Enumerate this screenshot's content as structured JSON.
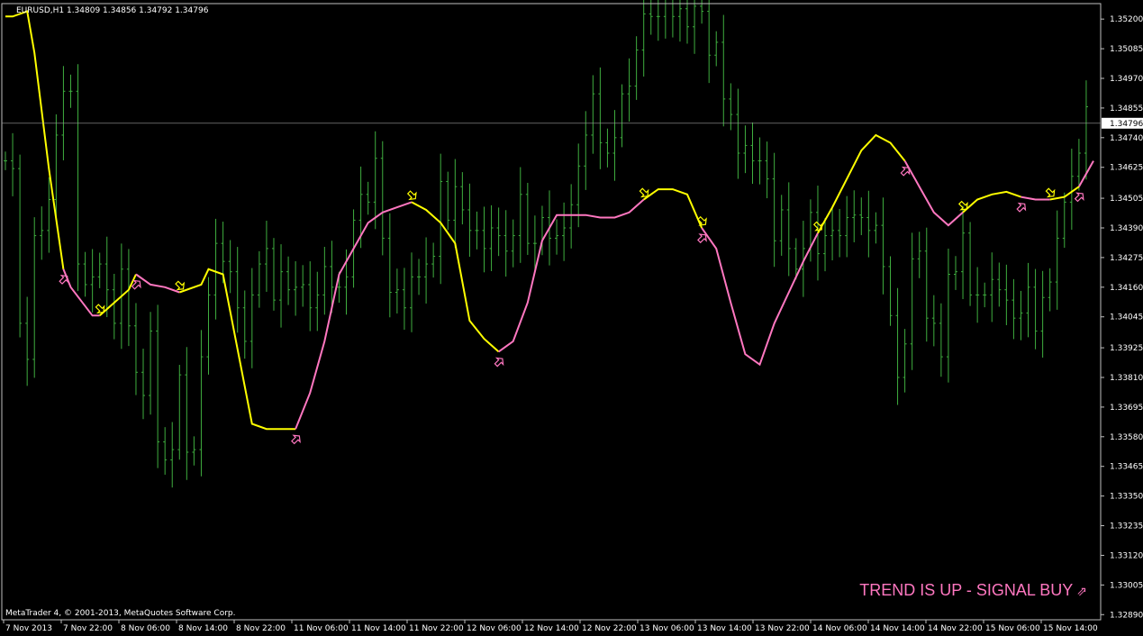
{
  "window": {
    "title": "EURUSD,H1  1.34809 1.34856 1.34792 1.34796",
    "copyright": "MetaTrader 4, © 2001-2013, MetaQuotes Software Corp."
  },
  "signal": {
    "text": "TREND IS UP - SIGNAL BUY",
    "arrow": "⇗",
    "color": "#ff77c0"
  },
  "colors": {
    "background": "#000000",
    "candles": "#3fae3f",
    "trend_up": "#ff77c0",
    "trend_down": "#ffff00",
    "axis": "#c0c0c0",
    "price_badge_bg": "#ffffff",
    "price_badge_text": "#000000"
  },
  "chart_data": {
    "type": "line",
    "symbol": "EURUSD",
    "timeframe": "H1",
    "current_price": "1.34796",
    "y_ticks": [
      "1.35200",
      "1.35085",
      "1.34970",
      "1.34855",
      "1.34740",
      "1.34625",
      "1.34505",
      "1.34390",
      "1.34275",
      "1.34160",
      "1.34045",
      "1.33925",
      "1.33810",
      "1.33695",
      "1.33580",
      "1.33465",
      "1.33350",
      "1.33235",
      "1.33120",
      "1.33005",
      "1.32890"
    ],
    "y_tick_values": [
      1.352,
      1.35085,
      1.3497,
      1.34855,
      1.3474,
      1.34625,
      1.34505,
      1.3439,
      1.34275,
      1.3416,
      1.34045,
      1.33925,
      1.3381,
      1.33695,
      1.3358,
      1.33465,
      1.3335,
      1.33235,
      1.3312,
      1.33005,
      1.3289
    ],
    "ylim": [
      1.3287,
      1.3526
    ],
    "x_ticks": [
      "7 Nov 2013",
      "7 Nov 22:00",
      "8 Nov 06:00",
      "8 Nov 14:00",
      "8 Nov 22:00",
      "11 Nov 06:00",
      "11 Nov 14:00",
      "11 Nov 22:00",
      "12 Nov 06:00",
      "12 Nov 14:00",
      "12 Nov 22:00",
      "13 Nov 06:00",
      "13 Nov 14:00",
      "13 Nov 22:00",
      "14 Nov 06:00",
      "14 Nov 14:00",
      "14 Nov 22:00",
      "15 Nov 06:00",
      "15 Nov 14:00"
    ],
    "bar_count": 150,
    "candles": {
      "closes": [
        1.3465,
        1.3462,
        1.3402,
        1.3388,
        1.3436,
        1.3438,
        1.345,
        1.3475,
        1.3492,
        1.3492,
        1.3425,
        1.3417,
        1.342,
        1.3425,
        1.3415,
        1.3402,
        1.3423,
        1.3401,
        1.3383,
        1.3374,
        1.3399,
        1.3356,
        1.3349,
        1.3353,
        1.3382,
        1.3352,
        1.3353,
        1.3389,
        1.3413,
        1.3433,
        1.3426,
        1.3422,
        1.3408,
        1.3395,
        1.3413,
        1.3425,
        1.3431,
        1.3411,
        1.3422,
        1.3415,
        1.3416,
        1.3417,
        1.3408,
        1.3413,
        1.3424,
        1.3416,
        1.3416,
        1.342,
        1.3442,
        1.3452,
        1.3449,
        1.3466,
        1.3435,
        1.3414,
        1.3415,
        1.3408,
        1.342,
        1.342,
        1.3425,
        1.3428,
        1.3457,
        1.3442,
        1.3455,
        1.3446,
        1.3438,
        1.3438,
        1.3431,
        1.3439,
        1.3436,
        1.343,
        1.3436,
        1.3452,
        1.3433,
        1.3433,
        1.3443,
        1.3435,
        1.3436,
        1.3439,
        1.3448,
        1.3463,
        1.3475,
        1.3491,
        1.3472,
        1.3468,
        1.3474,
        1.3491,
        1.3494,
        1.3508,
        1.3522,
        1.3521,
        1.3521,
        1.3526,
        1.3521,
        1.3524,
        1.3517,
        1.3525,
        1.3523,
        1.3506,
        1.3511,
        1.3489,
        1.3483,
        1.3468,
        1.3471,
        1.3465,
        1.3465,
        1.3458,
        1.3434,
        1.3446,
        1.3431,
        1.3423,
        1.3431,
        1.3445,
        1.3429,
        1.3436,
        1.3438,
        1.3436,
        1.3443,
        1.3444,
        1.3443,
        1.3438,
        1.344,
        1.3424,
        1.3405,
        1.3381,
        1.3394,
        1.3427,
        1.343,
        1.3404,
        1.3402,
        1.3389,
        1.3421,
        1.3422,
        1.3437,
        1.3413,
        1.3413,
        1.3413,
        1.3419,
        1.3415,
        1.3411,
        1.3404,
        1.3406,
        1.3416,
        1.3399,
        1.3412,
        1.3418,
        1.3435,
        1.3449,
        1.3459,
        1.3468,
        1.3486
      ]
    },
    "trend_line": [
      [
        0,
        1.3521
      ],
      [
        1,
        1.3521
      ],
      [
        3,
        1.3523
      ],
      [
        4,
        1.3507
      ],
      [
        6,
        1.3462
      ],
      [
        8,
        1.3423
      ],
      [
        9,
        1.3416
      ],
      [
        12,
        1.3405
      ],
      [
        13,
        1.3405
      ],
      [
        15,
        1.341
      ],
      [
        17,
        1.3415
      ],
      [
        18,
        1.3421
      ],
      [
        20,
        1.3417
      ],
      [
        22,
        1.3416
      ],
      [
        24,
        1.3414
      ],
      [
        27,
        1.3417
      ],
      [
        28,
        1.3423
      ],
      [
        30,
        1.3421
      ],
      [
        34,
        1.3363
      ],
      [
        36,
        1.3361
      ],
      [
        40,
        1.3361
      ],
      [
        42,
        1.3375
      ],
      [
        44,
        1.3395
      ],
      [
        46,
        1.3421
      ],
      [
        48,
        1.3431
      ],
      [
        50,
        1.3441
      ],
      [
        52,
        1.3445
      ],
      [
        54,
        1.3447
      ],
      [
        56,
        1.3449
      ],
      [
        58,
        1.3446
      ],
      [
        60,
        1.3441
      ],
      [
        62,
        1.3433
      ],
      [
        64,
        1.3403
      ],
      [
        66,
        1.3396
      ],
      [
        68,
        1.3391
      ],
      [
        70,
        1.3395
      ],
      [
        72,
        1.341
      ],
      [
        74,
        1.3434
      ],
      [
        76,
        1.3444
      ],
      [
        78,
        1.3444
      ],
      [
        80,
        1.3444
      ],
      [
        82,
        1.3443
      ],
      [
        84,
        1.3443
      ],
      [
        86,
        1.3445
      ],
      [
        88,
        1.345
      ],
      [
        90,
        1.3454
      ],
      [
        92,
        1.3454
      ],
      [
        94,
        1.3452
      ],
      [
        96,
        1.3439
      ],
      [
        98,
        1.3431
      ],
      [
        100,
        1.341
      ],
      [
        102,
        1.339
      ],
      [
        104,
        1.3386
      ],
      [
        106,
        1.3402
      ],
      [
        108,
        1.3414
      ],
      [
        110,
        1.3426
      ],
      [
        112,
        1.3437
      ],
      [
        114,
        1.3447
      ],
      [
        116,
        1.3458
      ],
      [
        118,
        1.3469
      ],
      [
        120,
        1.3475
      ],
      [
        122,
        1.3472
      ],
      [
        124,
        1.3465
      ],
      [
        126,
        1.3455
      ],
      [
        128,
        1.3445
      ],
      [
        130,
        1.344
      ],
      [
        132,
        1.3445
      ],
      [
        134,
        1.345
      ],
      [
        136,
        1.3452
      ],
      [
        138,
        1.3453
      ],
      [
        140,
        1.3451
      ],
      [
        142,
        1.345
      ],
      [
        144,
        1.345
      ],
      [
        146,
        1.3451
      ],
      [
        148,
        1.3455
      ],
      [
        150,
        1.3465
      ]
    ],
    "segments": [
      {
        "trend": "down",
        "from": 0,
        "to": 8
      },
      {
        "trend": "up",
        "from": 8,
        "to": 13
      },
      {
        "trend": "down",
        "from": 13,
        "to": 18
      },
      {
        "trend": "up",
        "from": 18,
        "to": 24
      },
      {
        "trend": "down",
        "from": 24,
        "to": 40
      },
      {
        "trend": "up",
        "from": 40,
        "to": 56
      },
      {
        "trend": "down",
        "from": 56,
        "to": 68
      },
      {
        "trend": "up",
        "from": 68,
        "to": 88
      },
      {
        "trend": "down",
        "from": 88,
        "to": 96
      },
      {
        "trend": "up",
        "from": 96,
        "to": 112
      },
      {
        "trend": "down",
        "from": 112,
        "to": 124
      },
      {
        "trend": "up",
        "from": 124,
        "to": 132
      },
      {
        "trend": "down",
        "from": 132,
        "to": 140
      },
      {
        "trend": "up",
        "from": 140,
        "to": 144
      },
      {
        "trend": "down",
        "from": 144,
        "to": 148
      },
      {
        "trend": "up",
        "from": 148,
        "to": 150
      }
    ],
    "signals": [
      {
        "bar": 8,
        "dir": "up"
      },
      {
        "bar": 13,
        "dir": "down"
      },
      {
        "bar": 18,
        "dir": "up"
      },
      {
        "bar": 24,
        "dir": "down"
      },
      {
        "bar": 40,
        "dir": "up"
      },
      {
        "bar": 56,
        "dir": "down"
      },
      {
        "bar": 68,
        "dir": "up"
      },
      {
        "bar": 88,
        "dir": "down"
      },
      {
        "bar": 96,
        "dir": "up"
      },
      {
        "bar": 96,
        "dir": "down"
      },
      {
        "bar": 112,
        "dir": "down"
      },
      {
        "bar": 124,
        "dir": "up"
      },
      {
        "bar": 132,
        "dir": "down"
      },
      {
        "bar": 140,
        "dir": "up"
      },
      {
        "bar": 144,
        "dir": "down"
      },
      {
        "bar": 148,
        "dir": "up"
      }
    ]
  }
}
